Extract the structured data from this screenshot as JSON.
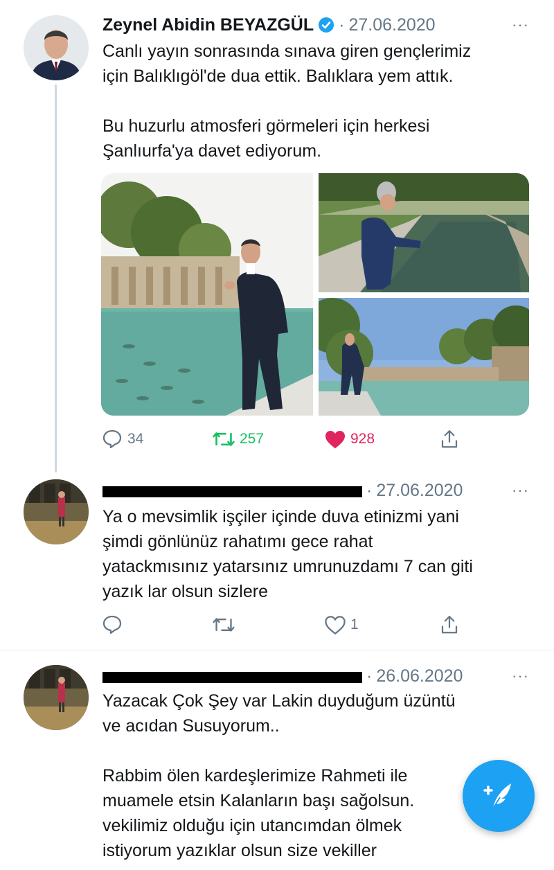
{
  "tweets": [
    {
      "author_name": "Zeynel Abidin BEYAZGÜL",
      "date": "27.06.2020",
      "more": "···",
      "text": "Canlı yayın sonrasında sınava giren gençlerimiz\niçin Balıklıgöl'de dua ettik. Balıklara yem attık.\n\nBu huzurlu atmosferi görmeleri için herkesi\nŞanlıurfa'ya davet ediyorum.",
      "replies": "34",
      "retweets": "257",
      "likes": "928"
    },
    {
      "author_name": "",
      "date": "27.06.2020",
      "more": "···",
      "text": "Ya o mevsimlik işçiler içinde duva etinizmi yani\nşimdi gönlünüz rahatımı gece rahat\nyatackmısınız yatarsınız umrunuzdamı 7 can giti\nyazık lar olsun sizlere",
      "likes": "1"
    },
    {
      "author_name": "",
      "date": "26.06.2020",
      "more": "···",
      "text": "Yazacak Çok Şey var Lakin duyduğum üzüntü\nve acıdan Susuyorum..\n\nRabbim ölen kardeşlerimize Rahmeti ile\nmuamele etsin Kalanların başı sağolsun.\nvekilimiz olduğu için utancımdan ölmek\nistiyorum yazıklar olsun size vekiller"
    }
  ],
  "colors": {
    "accent": "#1da1f2",
    "retweet_green": "#17bf63",
    "like_red": "#e0245e",
    "muted": "#657786"
  },
  "icons": {
    "reply": "reply-icon",
    "retweet": "retweet-icon",
    "like": "heart-icon",
    "share": "share-icon",
    "verified": "verified-badge-icon",
    "compose": "compose-tweet-icon"
  }
}
